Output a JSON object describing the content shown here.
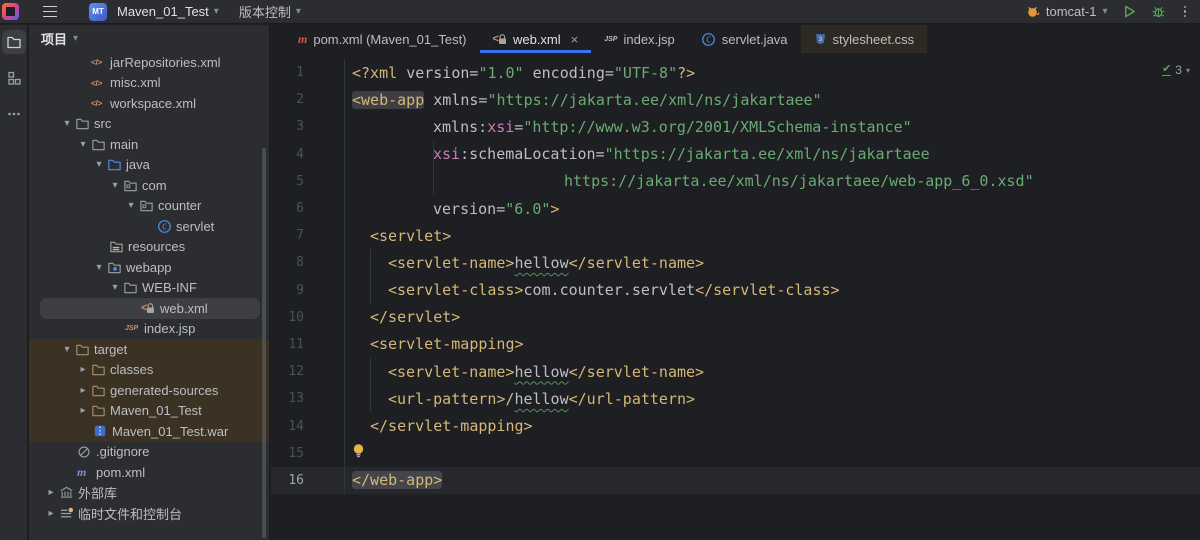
{
  "header": {
    "project_name": "Maven_01_Test",
    "vcs_label": "版本控制",
    "run_config": "tomcat-1"
  },
  "panel": {
    "title": "项目",
    "items": [
      {
        "label": "jarRepositories.xml",
        "icon": "xml",
        "pad": 62
      },
      {
        "label": "misc.xml",
        "icon": "xml",
        "pad": 62
      },
      {
        "label": "workspace.xml",
        "icon": "xml",
        "pad": 62
      },
      {
        "label": "src",
        "icon": "folder",
        "chevron": "down",
        "pad": 30
      },
      {
        "label": "main",
        "icon": "folder",
        "chevron": "down",
        "pad": 46
      },
      {
        "label": "java",
        "icon": "folder-src",
        "chevron": "down",
        "pad": 62
      },
      {
        "label": "com",
        "icon": "package",
        "chevron": "down",
        "pad": 78
      },
      {
        "label": "counter",
        "icon": "package",
        "chevron": "down",
        "pad": 94
      },
      {
        "label": "servlet",
        "icon": "class",
        "pad": 128
      },
      {
        "label": "resources",
        "icon": "folder-res",
        "pad": 80
      },
      {
        "label": "webapp",
        "icon": "folder-web",
        "chevron": "down",
        "pad": 62
      },
      {
        "label": "WEB-INF",
        "icon": "folder",
        "chevron": "down",
        "pad": 78
      },
      {
        "label": "web.xml",
        "icon": "webxml",
        "pad": 112,
        "selected": true
      },
      {
        "label": "index.jsp",
        "icon": "jsp",
        "pad": 96
      },
      {
        "label": "target",
        "icon": "folder-ex",
        "chevron": "down",
        "pad": 30,
        "excluded": true
      },
      {
        "label": "classes",
        "icon": "folder-ex",
        "chevron": "right",
        "pad": 46,
        "excluded": true
      },
      {
        "label": "generated-sources",
        "icon": "folder-ex",
        "chevron": "right",
        "pad": 46,
        "excluded": true
      },
      {
        "label": "Maven_01_Test",
        "icon": "folder-ex",
        "chevron": "right",
        "pad": 46,
        "excluded": true
      },
      {
        "label": "Maven_01_Test.war",
        "icon": "war",
        "pad": 64,
        "excluded": true
      },
      {
        "label": ".gitignore",
        "icon": "ignored",
        "pad": 48
      },
      {
        "label": "pom.xml",
        "icon": "maven-blue",
        "pad": 48
      },
      {
        "label": "外部库",
        "icon": "lib",
        "chevron": "right",
        "pad": 14
      },
      {
        "label": "临时文件和控制台",
        "icon": "scratch",
        "chevron": "right",
        "pad": 14
      }
    ]
  },
  "tabs": [
    {
      "label": "pom.xml (Maven_01_Test)",
      "icon": "maven-red"
    },
    {
      "label": "web.xml",
      "icon": "webxml",
      "active": true,
      "close": true
    },
    {
      "label": "index.jsp",
      "icon": "jsp"
    },
    {
      "label": "servlet.java",
      "icon": "class"
    },
    {
      "label": "stylesheet.css",
      "icon": "css",
      "tinted": true
    }
  ],
  "editor": {
    "inspection_count": "3",
    "file_language": "xml",
    "lines": [
      {
        "num": "1",
        "indent": 0,
        "segs": [
          [
            "t",
            "<?xml "
          ],
          [
            "a",
            "version="
          ],
          [
            "s",
            "\"1.0\""
          ],
          [
            "a",
            " encoding="
          ],
          [
            "s",
            "\"UTF-8\""
          ],
          [
            "t",
            "?>"
          ]
        ]
      },
      {
        "num": "2",
        "indent": 0,
        "segs": [
          [
            "tb",
            "<web-app"
          ],
          [
            "a",
            " xmlns="
          ],
          [
            "s",
            "\"https://jakarta.ee/xml/ns/jakartaee\""
          ]
        ]
      },
      {
        "num": "3",
        "indent": 81,
        "segs": [
          [
            "a",
            "xmlns:"
          ],
          [
            "n",
            "xsi"
          ],
          [
            "a",
            "="
          ],
          [
            "s",
            "\"http://www.w3.org/2001/XMLSchema-instance\""
          ]
        ]
      },
      {
        "num": "4",
        "indent": 81,
        "guide": 81,
        "segs": [
          [
            "n",
            "xsi"
          ],
          [
            "a",
            ":schemaLocation="
          ],
          [
            "s",
            "\"https://jakarta.ee/xml/ns/jakartaee"
          ]
        ]
      },
      {
        "num": "5",
        "indent": 212,
        "guide": 81,
        "segs": [
          [
            "s",
            "https://jakarta.ee/xml/ns/jakartaee/web-app_6_0.xsd\""
          ]
        ]
      },
      {
        "num": "6",
        "indent": 81,
        "segs": [
          [
            "a",
            "version="
          ],
          [
            "s",
            "\"6.0\""
          ],
          [
            "t",
            ">"
          ]
        ]
      },
      {
        "num": "7",
        "indent": 18,
        "segs": [
          [
            "t",
            "<servlet>"
          ]
        ]
      },
      {
        "num": "8",
        "indent": 36,
        "guide": 18,
        "segs": [
          [
            "t",
            "<servlet-name>"
          ],
          [
            "xw",
            "hellow"
          ],
          [
            "t",
            "</servlet-name>"
          ]
        ]
      },
      {
        "num": "9",
        "indent": 36,
        "guide": 18,
        "segs": [
          [
            "t",
            "<servlet-class>"
          ],
          [
            "x",
            "com.counter.servlet"
          ],
          [
            "t",
            "</servlet-class>"
          ]
        ]
      },
      {
        "num": "10",
        "indent": 18,
        "segs": [
          [
            "t",
            "</servlet>"
          ]
        ]
      },
      {
        "num": "11",
        "indent": 18,
        "segs": [
          [
            "t",
            "<servlet-mapping>"
          ]
        ]
      },
      {
        "num": "12",
        "indent": 36,
        "guide": 18,
        "segs": [
          [
            "t",
            "<servlet-name>"
          ],
          [
            "xw",
            "hellow"
          ],
          [
            "t",
            "</servlet-name>"
          ]
        ]
      },
      {
        "num": "13",
        "indent": 36,
        "guide": 18,
        "segs": [
          [
            "t",
            "<url-pattern>"
          ],
          [
            "x",
            "/"
          ],
          [
            "xw",
            "hellow"
          ],
          [
            "t",
            "</url-pattern>"
          ]
        ]
      },
      {
        "num": "14",
        "indent": 18,
        "segs": [
          [
            "t",
            "</servlet-mapping>"
          ]
        ]
      },
      {
        "num": "15",
        "indent": 0,
        "bulb": true,
        "segs": []
      },
      {
        "num": "16",
        "indent": 0,
        "current": true,
        "segs": [
          [
            "tb2",
            "</web-app>"
          ]
        ]
      }
    ]
  },
  "colors": {
    "accent_blue": "#3574f0",
    "tag_gold": "#d5b778",
    "string_green": "#6aab73",
    "namespace_pink": "#c77dbb",
    "excluded_brown": "#3c3223",
    "run_green": "#57a559",
    "maven_orange": "#cb5b41"
  }
}
